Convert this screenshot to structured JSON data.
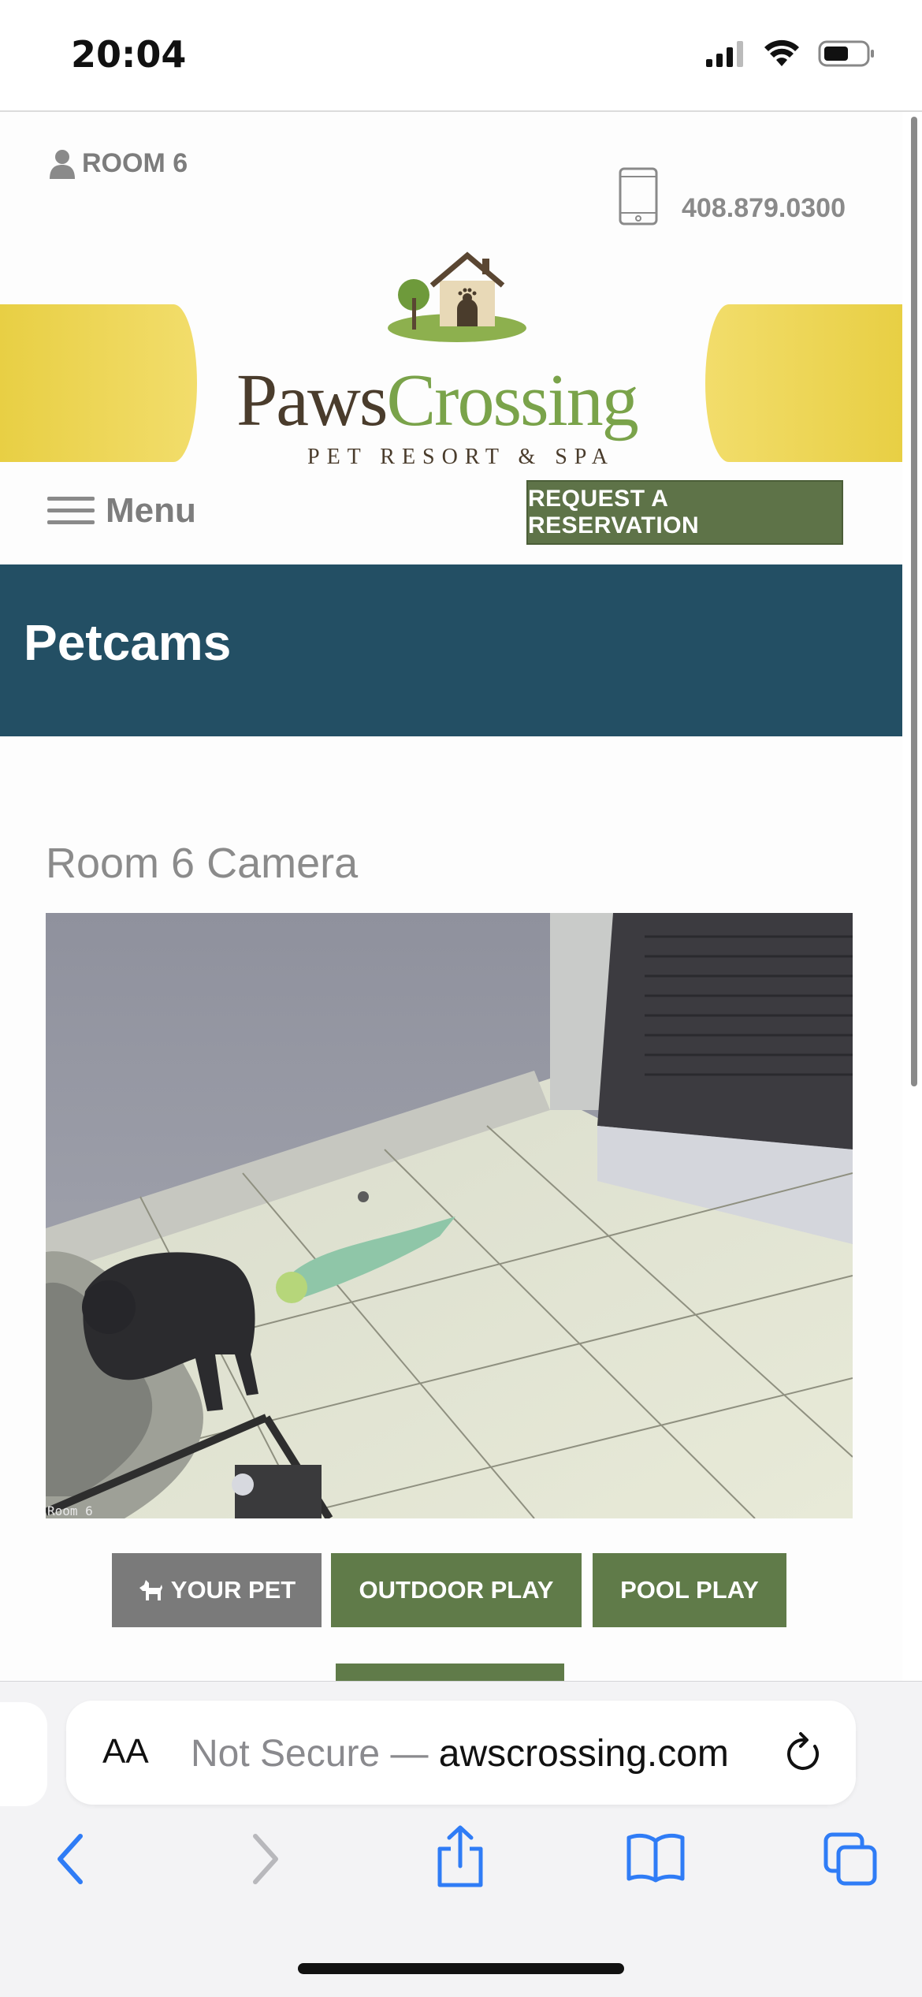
{
  "status_bar": {
    "time": "20:04"
  },
  "header": {
    "account_label": "ROOM 6",
    "phone": "408.879.0300"
  },
  "logo": {
    "name_part1": "Paws",
    "name_part2": "Crossing",
    "tagline": "PET RESORT & SPA"
  },
  "nav": {
    "menu_label": "Menu",
    "reserve_label": "REQUEST A RESERVATION"
  },
  "hero": {
    "title": "Petcams"
  },
  "camera": {
    "heading": "Room 6 Camera",
    "overlay_label": "Room 6"
  },
  "cam_buttons": [
    {
      "label": "YOUR PET"
    },
    {
      "label": "OUTDOOR PLAY"
    },
    {
      "label": "POOL PLAY"
    }
  ],
  "browser": {
    "text_size_label": "AA",
    "address_prefix": "Not Secure — ",
    "address_domain": "awscrossing.com"
  },
  "colors": {
    "hero_bg": "#234f64",
    "button_green": "#607b49",
    "button_gray": "#7a7a7a",
    "logo_yellow": "#e8cf44",
    "logo_brown": "#4a3c2c",
    "logo_green": "#7aa34a",
    "safari_blue": "#2f7cf6"
  },
  "icons": {
    "account": "person-icon",
    "phone": "mobile-phone-icon",
    "menu": "hamburger-icon",
    "your_pet": "dog-icon",
    "reload": "reload-icon",
    "back": "back-chevron-icon",
    "forward": "forward-chevron-icon",
    "share": "share-icon",
    "bookmarks": "book-icon",
    "tabs": "tabs-icon"
  }
}
